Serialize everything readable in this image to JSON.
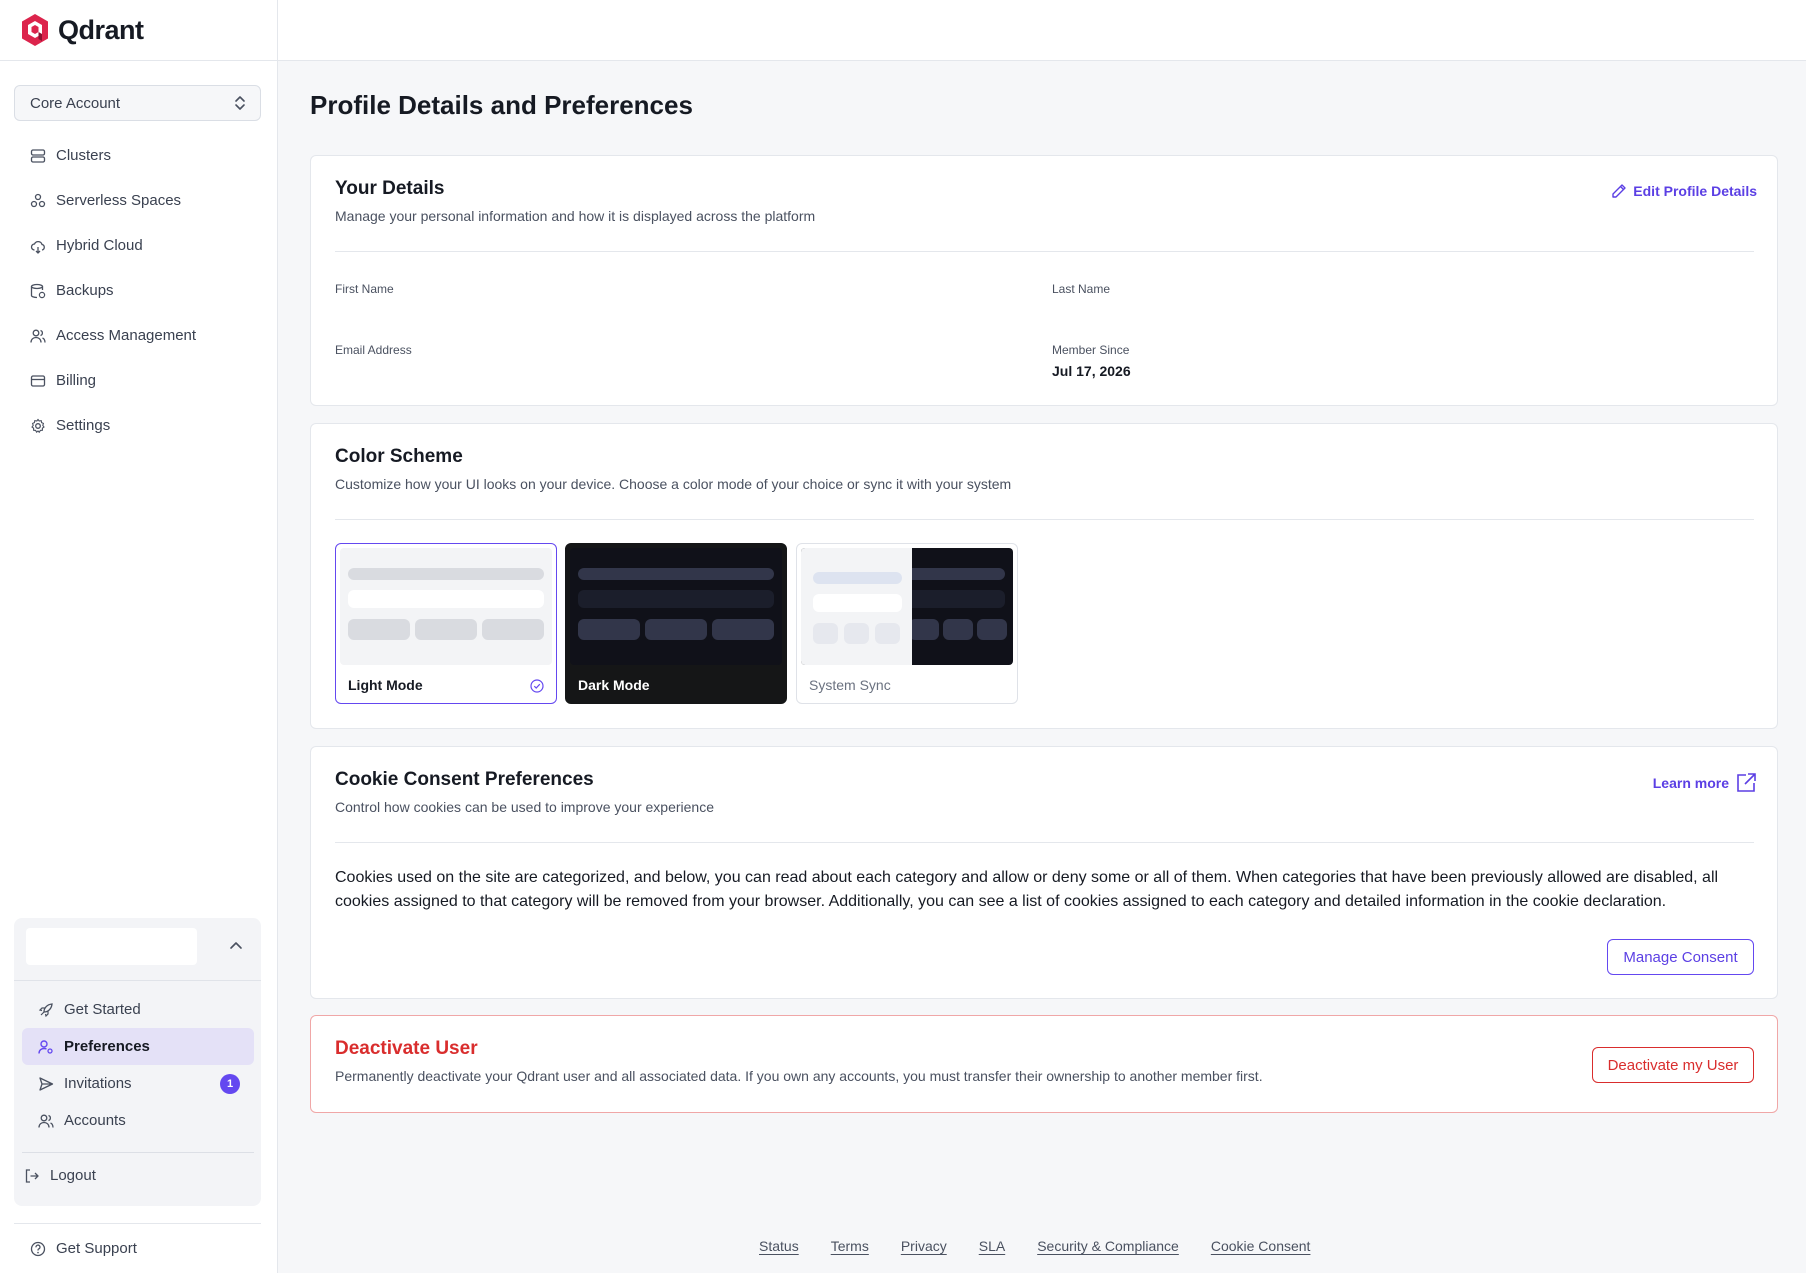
{
  "brand": {
    "name": "Qdrant",
    "color": "#dc244c",
    "accent": "#6448f0"
  },
  "account_select": {
    "value": "Core Account"
  },
  "nav": [
    {
      "label": "Clusters",
      "icon": "server-icon"
    },
    {
      "label": "Serverless Spaces",
      "icon": "molecules-icon"
    },
    {
      "label": "Hybrid Cloud",
      "icon": "cloud-icon"
    },
    {
      "label": "Backups",
      "icon": "database-backup-icon"
    },
    {
      "label": "Access Management",
      "icon": "users-icon"
    },
    {
      "label": "Billing",
      "icon": "credit-card-icon"
    },
    {
      "label": "Settings",
      "icon": "gear-icon"
    }
  ],
  "user_menu": {
    "items": [
      {
        "label": "Get Started",
        "icon": "rocket-icon"
      },
      {
        "label": "Preferences",
        "icon": "user-cog-icon",
        "active": true
      },
      {
        "label": "Invitations",
        "icon": "send-icon",
        "badge": "1"
      },
      {
        "label": "Accounts",
        "icon": "users-icon"
      }
    ],
    "logout": "Logout"
  },
  "support": "Get Support",
  "page": {
    "title": "Profile Details and Preferences"
  },
  "details": {
    "title": "Your Details",
    "subtitle": "Manage your personal information and how it is displayed across the platform",
    "edit_label": "Edit Profile Details",
    "first_name_label": "First Name",
    "last_name_label": "Last Name",
    "email_label": "Email Address",
    "member_since_label": "Member Since",
    "member_since_value": "Jul 17, 2026"
  },
  "color_scheme": {
    "title": "Color Scheme",
    "subtitle": "Customize how your UI looks on your device. Choose a color mode of your choice or sync it with your system",
    "modes": [
      {
        "label": "Light Mode",
        "selected": true
      },
      {
        "label": "Dark Mode",
        "selected": false
      },
      {
        "label": "System Sync",
        "selected": false
      }
    ]
  },
  "cookies": {
    "title": "Cookie Consent Preferences",
    "subtitle": "Control how cookies can be used to improve your experience",
    "learn_more": "Learn more",
    "body": "Cookies used on the site are categorized, and below, you can read about each category and allow or deny some or all of them. When categories that have been previously allowed are disabled, all cookies assigned to that category will be removed from your browser. Additionally, you can see a list of cookies assigned to each category and detailed information in the cookie declaration.",
    "button": "Manage Consent"
  },
  "deactivate": {
    "title": "Deactivate User",
    "subtitle": "Permanently deactivate your Qdrant user and all associated data. If you own any accounts, you must transfer their ownership to another member first.",
    "button": "Deactivate my User",
    "color": "#d92d2d"
  },
  "footer": [
    "Status",
    "Terms",
    "Privacy",
    "SLA",
    "Security & Compliance",
    "Cookie Consent"
  ]
}
